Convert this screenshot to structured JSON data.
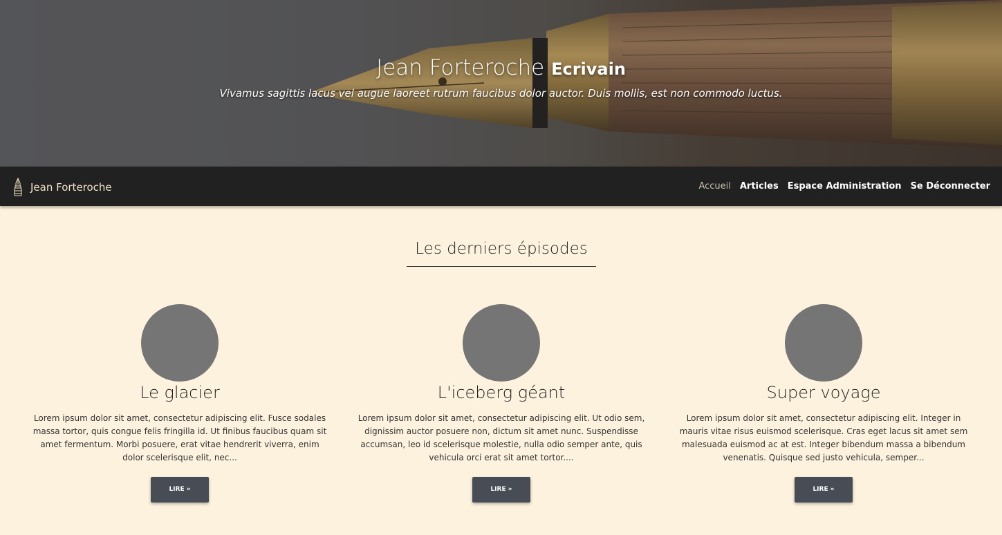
{
  "hero": {
    "name": "Jean Forteroche",
    "role": "Ecrivain",
    "tagline": "Vivamus sagittis lacus vel augue laoreet rutrum faucibus dolor auctor. Duis mollis, est non commodo luctus."
  },
  "navbar": {
    "brand_icon": "fountain-pen-icon",
    "brand": "Jean Forteroche",
    "links": [
      "Accueil",
      "Articles",
      "Espace Administration",
      "Se Déconnecter"
    ]
  },
  "main": {
    "section_title": "Les derniers épisodes",
    "episodes": [
      {
        "title": "Le glacier",
        "excerpt": "Lorem ipsum dolor sit amet, consectetur adipiscing elit. Fusce sodales massa tortor, quis congue felis fringilla id. Ut finibus faucibus quam sit amet fermentum. Morbi posuere, erat vitae hendrerit viverra, enim dolor scelerisque elit, nec...",
        "button": "LIRE »"
      },
      {
        "title": "L'iceberg géant",
        "excerpt": "Lorem ipsum dolor sit amet, consectetur adipiscing elit. Ut odio sem, dignissim auctor posuere non, dictum sit amet nunc. Suspendisse accumsan, leo id scelerisque molestie, nulla odio semper ante, quis vehicula orci erat sit amet tortor....",
        "button": "LIRE »"
      },
      {
        "title": "Super voyage",
        "excerpt": "Lorem ipsum dolor sit amet, consectetur adipiscing elit. Integer in mauris vitae risus euismod scelerisque. Cras eget lacus sit amet sem malesuada euismod ac at est. Integer bibendum massa a bibendum venenatis. Quisque sed justo vehicula, semper...",
        "button": "LIRE »"
      }
    ]
  },
  "colors": {
    "page_background": "#fdf2de",
    "navbar": "#212121",
    "button": "#474c55",
    "avatar_placeholder": "#757575"
  }
}
